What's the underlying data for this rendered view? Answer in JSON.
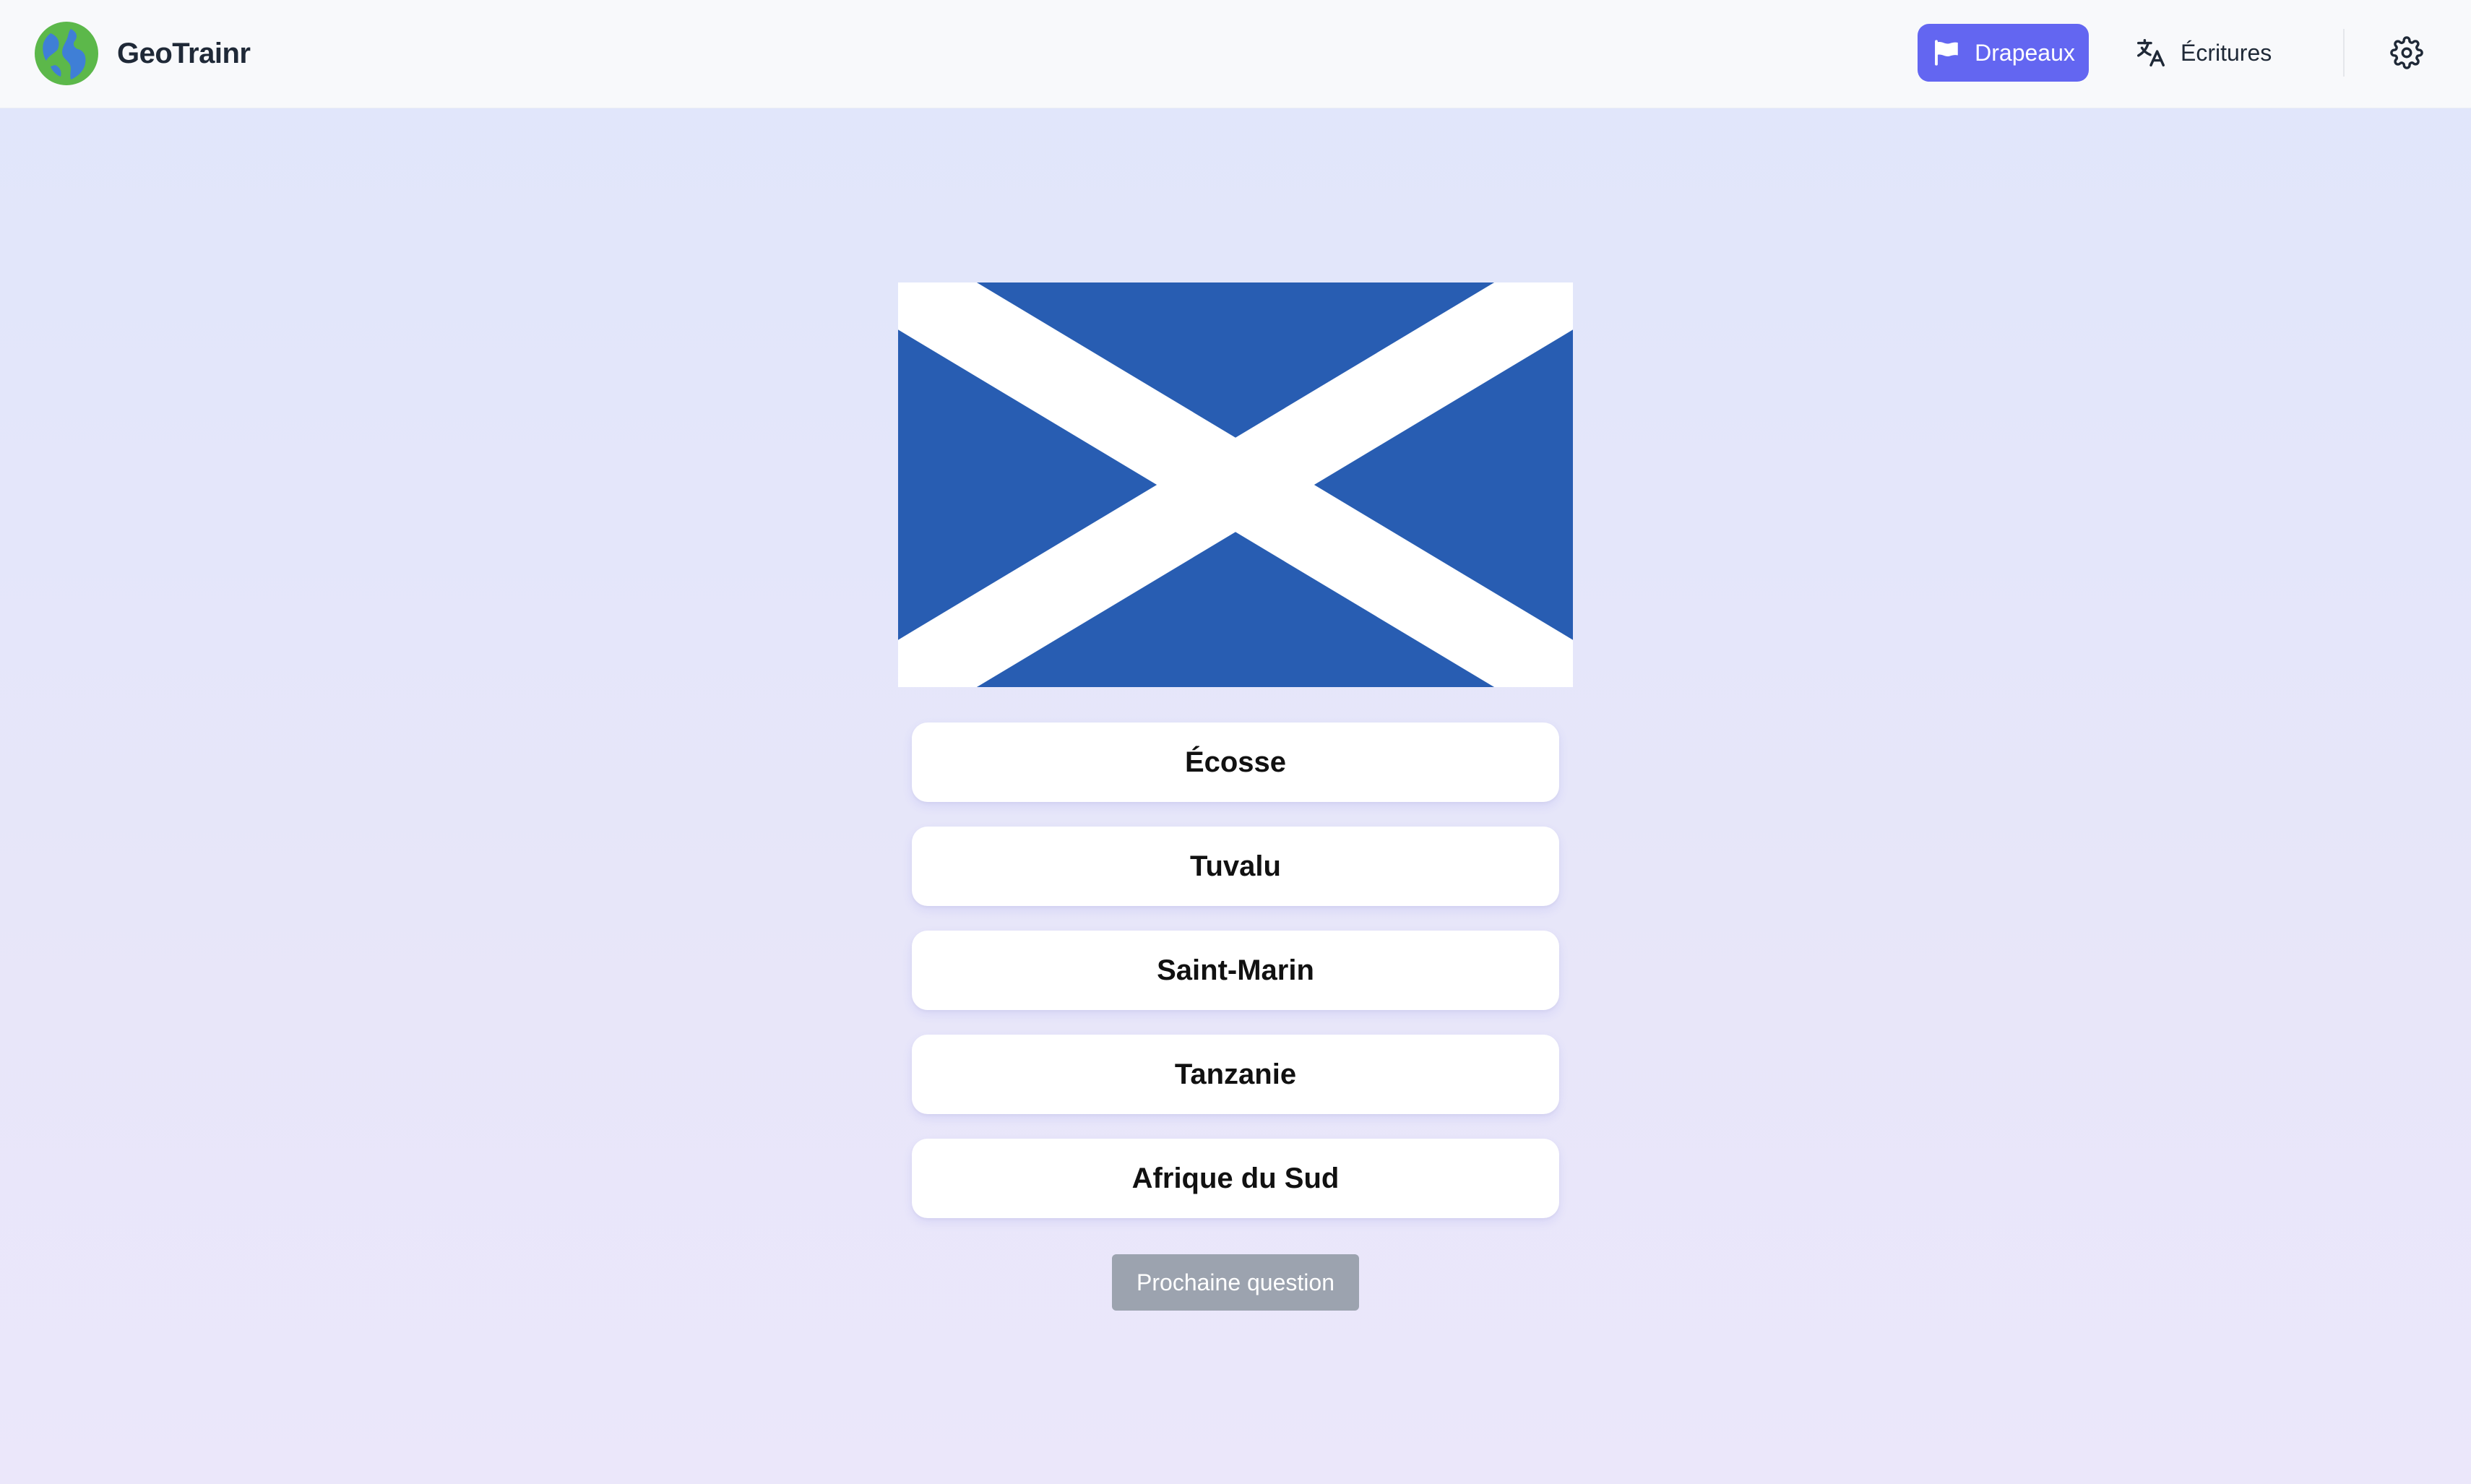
{
  "app": {
    "name": "GeoTrainr"
  },
  "nav": {
    "flags_label": "Drapeaux",
    "scripts_label": "Écritures"
  },
  "colors": {
    "accent": "#6366f1",
    "flag_blue": "#285db2",
    "disabled_button": "#9ca3af"
  },
  "icons": {
    "logo": "globe-icon",
    "flags": "flag-icon",
    "scripts": "translate-icon",
    "settings": "gear-icon"
  },
  "quiz": {
    "answers": [
      {
        "label": "Écosse"
      },
      {
        "label": "Tuvalu"
      },
      {
        "label": "Saint-Marin"
      },
      {
        "label": "Tanzanie"
      },
      {
        "label": "Afrique du Sud"
      }
    ],
    "next_label": "Prochaine question"
  }
}
